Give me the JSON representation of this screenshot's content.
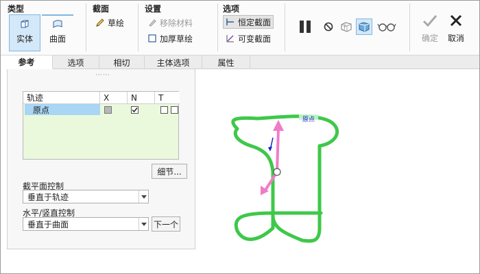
{
  "ribbon": {
    "groups": {
      "type": "类型",
      "section": "截面",
      "settings": "设置",
      "options": "选项"
    },
    "type_buttons": {
      "solid": "实体",
      "surface": "曲面"
    },
    "section_buttons": {
      "sketch": "草绘"
    },
    "settings_buttons": {
      "remove_material": "移除材料",
      "thicken_sketch": "加厚草绘"
    },
    "options_buttons": {
      "constant_section": "恒定截面",
      "variable_section": "可变截面"
    },
    "actions": {
      "ok": "确定",
      "cancel": "取消"
    }
  },
  "tabs": [
    {
      "label": "参考",
      "active": true
    },
    {
      "label": "选项"
    },
    {
      "label": "相切"
    },
    {
      "label": "主体选项"
    },
    {
      "label": "属性"
    }
  ],
  "panel": {
    "grip": "⋯⋯",
    "trajectory_table": {
      "headers": [
        "轨迹",
        "X",
        "N",
        "T"
      ],
      "rows": [
        {
          "name": "原点",
          "x": false,
          "n": true,
          "t": [
            false,
            false
          ]
        }
      ]
    },
    "details_button": "细节...",
    "section_plane_control": {
      "label": "截平面控制",
      "value": "垂直于轨迹"
    },
    "horizontal_vertical_control": {
      "label": "水平/竖直控制",
      "value": "垂直于曲面"
    },
    "next_button": "下一个"
  },
  "canvas": {
    "origin_label": "原点",
    "colors": {
      "trajectory": "#3ec84a",
      "arrow": "#f07cc8",
      "small_arrow": "#1a23c8"
    }
  }
}
